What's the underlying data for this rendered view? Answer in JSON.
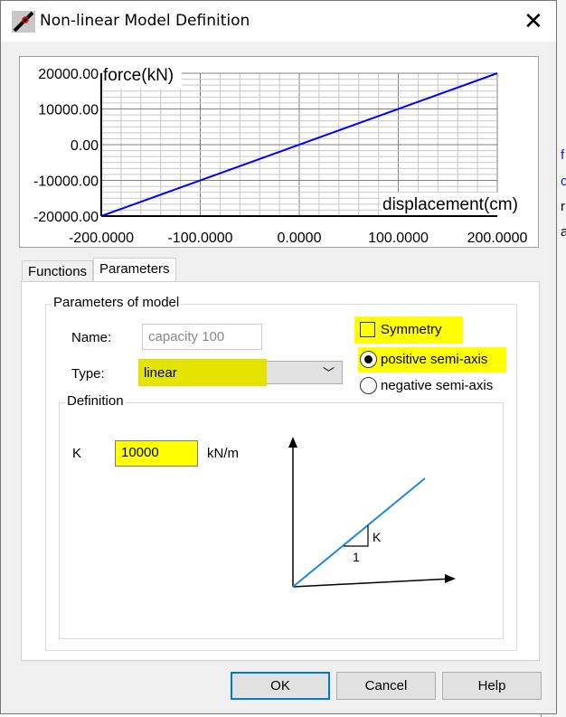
{
  "background_window": {
    "fragments": [
      "f",
      "c",
      "r",
      "a"
    ]
  },
  "window": {
    "title": "Non-linear Model Definition",
    "icon": "app-icon",
    "close_icon": "close-icon"
  },
  "chart_data": {
    "type": "line",
    "xlabel": "displacement(cm)",
    "ylabel": "force(kN)",
    "xlim": [
      -200,
      200
    ],
    "ylim": [
      -20000,
      20000
    ],
    "x_ticks": [
      "-200.0000",
      "-100.0000",
      "0.0000",
      "100.0000",
      "200.0000"
    ],
    "y_ticks": [
      "20000.00",
      "10000.00",
      "0.00",
      "-10000.00",
      "-20000.00"
    ],
    "grid": true,
    "line_color": "#0000ff",
    "series": [
      {
        "name": "force",
        "x": [
          -200,
          200
        ],
        "y": [
          -20000,
          20000
        ]
      }
    ]
  },
  "tabs": [
    {
      "label": "Functions",
      "active": false
    },
    {
      "label": "Parameters",
      "active": true
    }
  ],
  "params": {
    "group_label": "Parameters of model",
    "name_label": "Name:",
    "name_value": "capacity 100",
    "type_label": "Type:",
    "type_value": "linear",
    "symmetry_label": "Symmetry",
    "symmetry_checked": false,
    "positive_label": "positive semi-axis",
    "negative_label": "negative semi-axis",
    "selected": "positive"
  },
  "definition": {
    "group_label": "Definition",
    "k_label": "K",
    "k_value": "10000",
    "k_unit": "kN/m",
    "diagram_k": "K",
    "diagram_one": "1"
  },
  "buttons": {
    "ok": "OK",
    "cancel": "Cancel",
    "help": "Help"
  },
  "colors": {
    "highlight": "#ffff00",
    "accent": "#0078d7",
    "curve": "#0000ff",
    "diagram_line": "#1e88e5"
  }
}
